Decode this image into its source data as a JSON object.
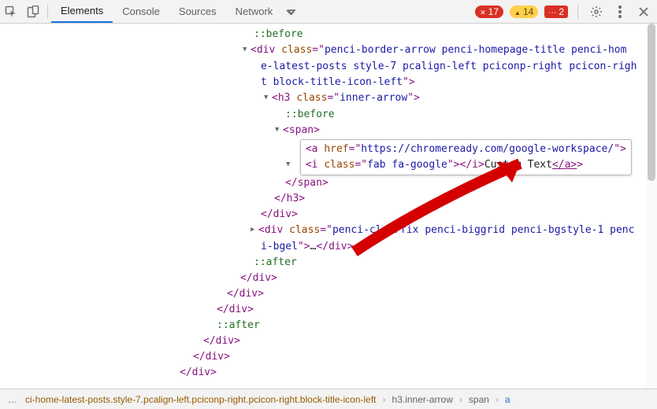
{
  "toolbar": {
    "tabs": {
      "elements": "Elements",
      "console": "Console",
      "sources": "Sources",
      "network": "Network"
    },
    "badges": {
      "errors": "17",
      "warnings": "14",
      "messages": "2"
    }
  },
  "dom": {
    "pseudo_before": "::before",
    "pseudo_after": "::after",
    "div_open_pre": "div",
    "attr_class": "class",
    "div1_class_val": "penci-border-arrow penci-homepage-title penci-home-latest-posts style-7 pcalign-left pciconp-right pcicon-right block-title-icon-left",
    "h3_tag": "h3",
    "h3_class_val": "inner-arrow",
    "span_tag": "span",
    "a_tag": "a",
    "attr_href": "href",
    "a_href_val": "https://chromeready.com/google-workspace/",
    "i_tag": "i",
    "i_class_val": "fab fa-google",
    "i_close": "</i>",
    "a_text": "Custom Text",
    "a_close": "</a>",
    "span_close": "</span>",
    "h3_close": "</h3>",
    "div_close": "</div>",
    "div2_class_val": "penci-clearfix penci-biggrid penci-bgstyle-1 penci-bgel",
    "ellipsis": "…"
  },
  "crumbs": {
    "more": "…",
    "c1": "ci-home-latest-posts.style-7.pcalign-left.pciconp-right.pcicon-right.block-title-icon-left",
    "c2": "h3.inner-arrow",
    "c3": "span",
    "c4": "a"
  }
}
